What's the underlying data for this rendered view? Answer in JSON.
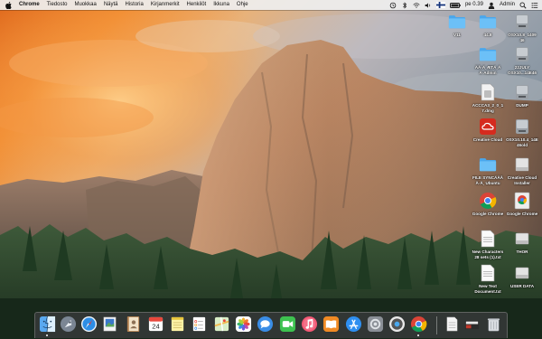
{
  "menubar": {
    "app_name": "Chrome",
    "menus": [
      "Tiedosto",
      "Muokkaa",
      "Näytä",
      "Historia",
      "Kirjanmerkit",
      "Henkilöt",
      "Ikkuna",
      "Ohje"
    ],
    "clock": "pe 0.39",
    "user": "Admin"
  },
  "desktop_icons": [
    {
      "label": "V11"
    },
    {
      "label": "44.8"
    },
    {
      "label": "OSX10.8_1409\n46"
    },
    {
      "label": "ÄÃ·Ä¸ÆTÄ¸Ä\nÄ·Admin"
    },
    {
      "label": "22JULY\nOSX10...14E46"
    },
    {
      "label": "ACCCA3_2_0_1\n7.dmg"
    },
    {
      "label": "DUMP"
    },
    {
      "label": "Creative Cloud"
    },
    {
      "label": "OSX10.10.4_14E\n46old"
    },
    {
      "label": "FILE SYNCÄÄÃ\nÄ·Ä¸ Ubuntu"
    },
    {
      "label": "Creative Cloud\nInstaller"
    },
    {
      "label": "Google Chrome"
    },
    {
      "label": "Google Chrome"
    },
    {
      "label": "New Characters\n28 sets (1).txt"
    },
    {
      "label": "THOR"
    },
    {
      "label": "New Text\nDocument.txt"
    },
    {
      "label": "USER DATA"
    }
  ],
  "dock": {
    "items": [
      "Finder",
      "Launchpad",
      "Safari",
      "Preview",
      "Contacts",
      "Calendar",
      "Notes",
      "Reminders",
      "Maps",
      "Photos",
      "Messages",
      "FaceTime",
      "Music",
      "iBooks",
      "App Store",
      "System Preferences",
      "Chrome Remote",
      "Google Chrome",
      "Documents",
      "Downloads",
      "Trash"
    ],
    "calendar_day": "24",
    "calendar_month": "JUL"
  }
}
